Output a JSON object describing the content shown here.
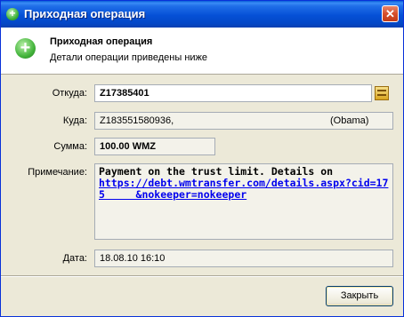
{
  "window": {
    "title": "Приходная операция",
    "close_glyph": "✕"
  },
  "header": {
    "title": "Приходная операция",
    "subtitle": "Детали операции приведены ниже",
    "icon": "plus-circle-icon"
  },
  "form": {
    "from": {
      "label": "Откуда:",
      "value": "Z17385401"
    },
    "to": {
      "label": "Куда:",
      "value": "Z183551580936,",
      "suffix": "(Obama)"
    },
    "amount": {
      "label": "Сумма:",
      "value": "100.00 WMZ"
    },
    "note": {
      "label": "Примечание:",
      "text": "Payment on the trust limit. Details on",
      "link": "https://debt.wmtransfer.com/details.aspx?cid=175     &nokeeper=nokeeper"
    },
    "date": {
      "label": "Дата:",
      "value": "18.08.10 16:10"
    }
  },
  "footer": {
    "close_button": "Закрыть"
  },
  "colors": {
    "titlebar": "#0550d6",
    "window_bg": "#ece9d8",
    "link": "#0000ee",
    "field_border": "#a5acb5"
  }
}
